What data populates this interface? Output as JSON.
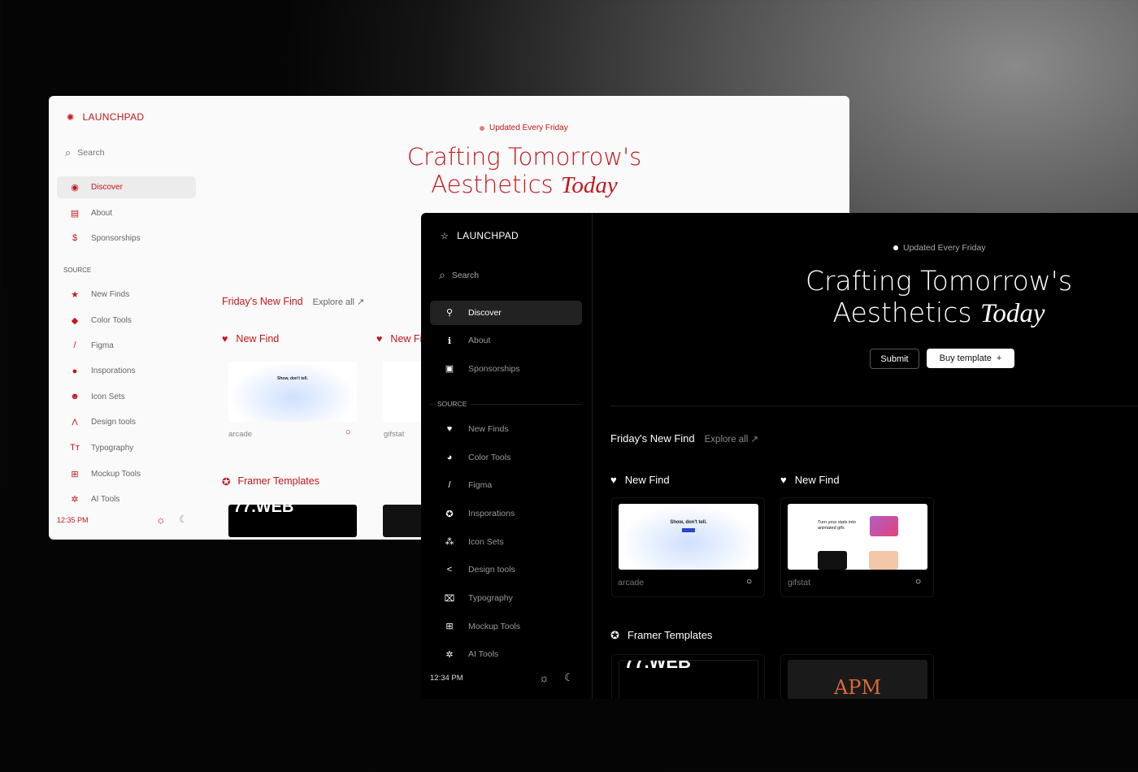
{
  "light": {
    "brand": "LAUNCHPAD",
    "search_placeholder": "Search",
    "nav": [
      {
        "label": "Discover",
        "icon": "discover-icon",
        "glyph": "◉",
        "active": true
      },
      {
        "label": "About",
        "icon": "document-icon",
        "glyph": "▤"
      },
      {
        "label": "Sponsorships",
        "icon": "dollar-icon",
        "glyph": "$"
      }
    ],
    "source_label": "SOURCE",
    "sources": [
      {
        "label": "New Finds",
        "icon": "star-icon",
        "glyph": "★"
      },
      {
        "label": "Color Tools",
        "icon": "paint-bucket-icon",
        "glyph": "◆"
      },
      {
        "label": "Figma",
        "icon": "brush-icon",
        "glyph": "/"
      },
      {
        "label": "Insporations",
        "icon": "lightbulb-icon",
        "glyph": "●"
      },
      {
        "label": "Icon Sets",
        "icon": "smiley-icon",
        "glyph": "☻"
      },
      {
        "label": "Design tools",
        "icon": "compass-icon",
        "glyph": "Λ"
      },
      {
        "label": "Typography",
        "icon": "text-icon",
        "glyph": "Tт"
      },
      {
        "label": "Mockup Tools",
        "icon": "mockup-icon",
        "glyph": "⊞"
      },
      {
        "label": "AI Tools",
        "icon": "ai-icon",
        "glyph": "✲"
      }
    ],
    "time": "12:35 PM",
    "updated": "Updated Every Friday",
    "title_line1": "Crafting Tomorrow's",
    "title_line2": "Aesthetics",
    "title_italic": "Today",
    "section_title": "Friday's New Find",
    "explore_all": "Explore all",
    "cards": [
      {
        "heading": "New Find",
        "name": "arcade"
      },
      {
        "heading": "New Find",
        "name": "gifstat"
      }
    ],
    "templates_title": "Framer Templates",
    "accent": "#c4161c"
  },
  "dark": {
    "brand": "LAUNCHPAD",
    "search_placeholder": "Search",
    "nav": [
      {
        "label": "Discover",
        "icon": "discover-icon",
        "glyph": "⚲",
        "active": true
      },
      {
        "label": "About",
        "icon": "info-icon",
        "glyph": "ℹ"
      },
      {
        "label": "Sponsorships",
        "icon": "cake-icon",
        "glyph": "▣"
      }
    ],
    "source_label": "SOURCE",
    "sources": [
      {
        "label": "New Finds",
        "icon": "heart-icon",
        "glyph": "♥"
      },
      {
        "label": "Color Tools",
        "icon": "palette-icon",
        "glyph": "◕"
      },
      {
        "label": "Figma",
        "icon": "brush-icon",
        "glyph": "/"
      },
      {
        "label": "Insporations",
        "icon": "star-circle-icon",
        "glyph": "✪"
      },
      {
        "label": "Icon Sets",
        "icon": "icon-sets-icon",
        "glyph": "⁂"
      },
      {
        "label": "Design tools",
        "icon": "share-icon",
        "glyph": "<"
      },
      {
        "label": "Typography",
        "icon": "text-frame-icon",
        "glyph": "⌧"
      },
      {
        "label": "Mockup Tools",
        "icon": "mockup-icon",
        "glyph": "⊞"
      },
      {
        "label": "AI Tools",
        "icon": "ai-icon",
        "glyph": "✲"
      }
    ],
    "time": "12:34 PM",
    "updated": "Updated Every Friday",
    "title_line1": "Crafting Tomorrow's",
    "title_line2": "Aesthetics",
    "title_italic": "Today",
    "submit_label": "Submit",
    "buy_label": "Buy template",
    "section_title": "Friday's New Find",
    "explore_all": "Explore all",
    "cards": [
      {
        "heading": "New Find",
        "name": "arcade"
      },
      {
        "heading": "New Find",
        "name": "gifstat"
      }
    ],
    "templates_title": "Framer Templates"
  },
  "previews": {
    "arcade_headline": "Show, don't tell.",
    "gifstat_headline": "Turn your stats into animated gifs",
    "template1_text": "77.WEB",
    "template2_text": "APM"
  }
}
